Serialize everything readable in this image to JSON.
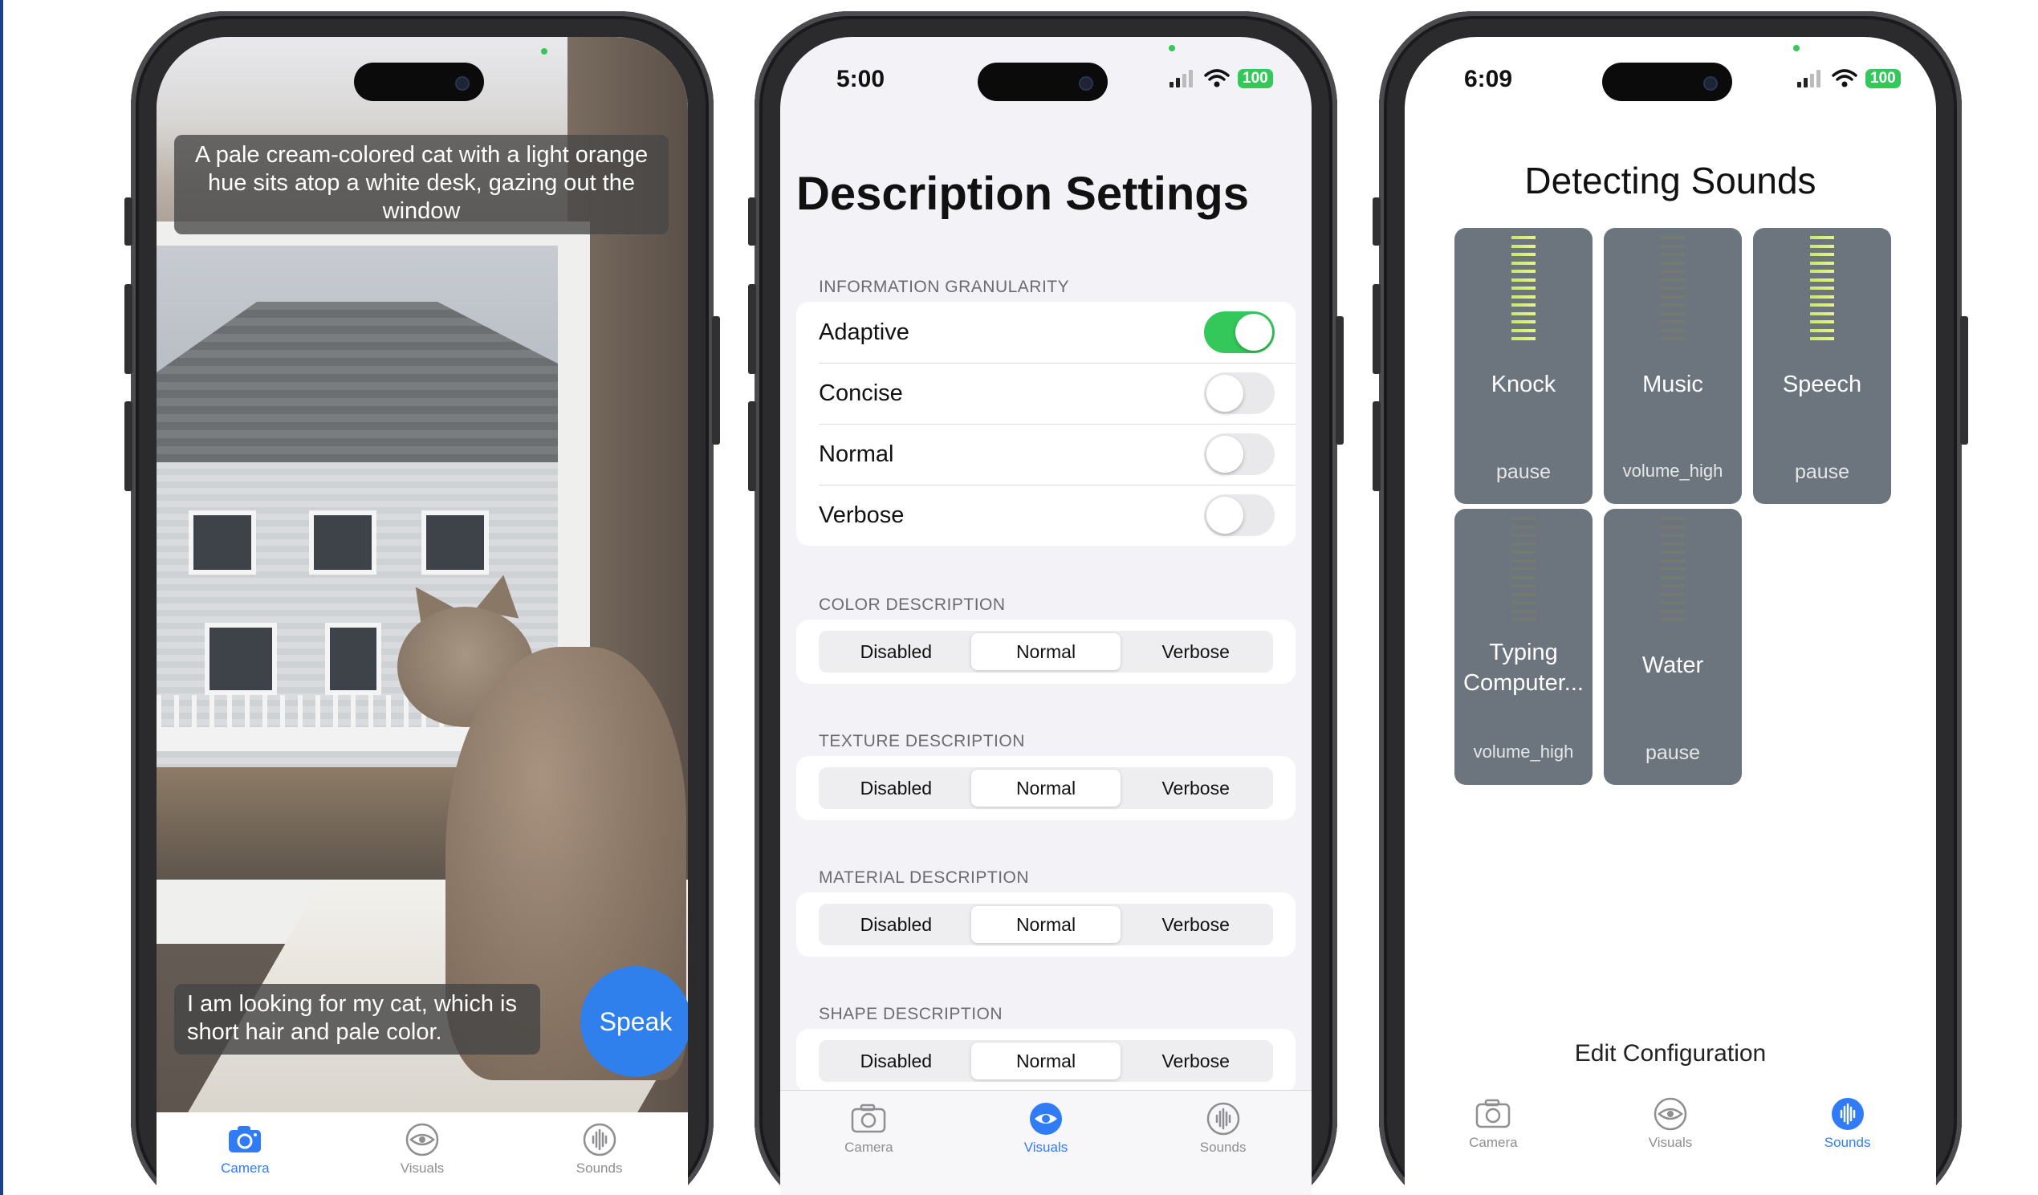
{
  "phone_camera": {
    "caption_description": "A pale cream-colored cat with a light orange hue sits atop a white desk, gazing out the window",
    "caption_query": "I am looking for my cat, which is short hair and pale color.",
    "speak_button": "Speak",
    "tabs": [
      {
        "label": "Camera",
        "icon": "camera-icon",
        "active": true
      },
      {
        "label": "Visuals",
        "icon": "eye-icon",
        "active": false
      },
      {
        "label": "Sounds",
        "icon": "waveform-icon",
        "active": false
      }
    ]
  },
  "phone_settings": {
    "status_time": "5:00",
    "battery": "100",
    "title": "Description Settings",
    "granularity": {
      "header": "INFORMATION GRANULARITY",
      "options": [
        {
          "label": "Adaptive",
          "on": true
        },
        {
          "label": "Concise",
          "on": false
        },
        {
          "label": "Normal",
          "on": false
        },
        {
          "label": "Verbose",
          "on": false
        }
      ]
    },
    "sections": [
      {
        "header": "COLOR DESCRIPTION",
        "segments": [
          "Disabled",
          "Normal",
          "Verbose"
        ],
        "selected": "Normal"
      },
      {
        "header": "TEXTURE DESCRIPTION",
        "segments": [
          "Disabled",
          "Normal",
          "Verbose"
        ],
        "selected": "Normal"
      },
      {
        "header": "MATERIAL DESCRIPTION",
        "segments": [
          "Disabled",
          "Normal",
          "Verbose"
        ],
        "selected": "Normal"
      },
      {
        "header": "SHAPE DESCRIPTION",
        "segments": [
          "Disabled",
          "Normal",
          "Verbose"
        ],
        "selected": "Normal"
      }
    ],
    "tabs": [
      {
        "label": "Camera",
        "icon": "camera-icon",
        "active": false
      },
      {
        "label": "Visuals",
        "icon": "eye-icon",
        "active": true
      },
      {
        "label": "Sounds",
        "icon": "waveform-icon",
        "active": false
      }
    ]
  },
  "phone_sounds": {
    "status_time": "6:09",
    "battery": "100",
    "title": "Detecting Sounds",
    "tiles": [
      {
        "name": "Knock",
        "state": "pause",
        "level_active": true
      },
      {
        "name": "Music",
        "state": "volume_high",
        "level_active": false
      },
      {
        "name": "Speech",
        "state": "pause",
        "level_active": true
      },
      {
        "name": "Typing Computer...",
        "state": "volume_high",
        "level_active": false
      },
      {
        "name": "Water",
        "state": "pause",
        "level_active": false
      }
    ],
    "edit_config": "Edit Configuration",
    "tabs": [
      {
        "label": "Camera",
        "icon": "camera-icon",
        "active": false
      },
      {
        "label": "Visuals",
        "icon": "eye-icon",
        "active": false
      },
      {
        "label": "Sounds",
        "icon": "waveform-icon",
        "active": true
      }
    ]
  },
  "colors": {
    "accent_blue": "#2f7cf6",
    "toggle_green": "#34c759",
    "tile_gray": "#6c757d",
    "meter_active": "#d7ee7a"
  }
}
